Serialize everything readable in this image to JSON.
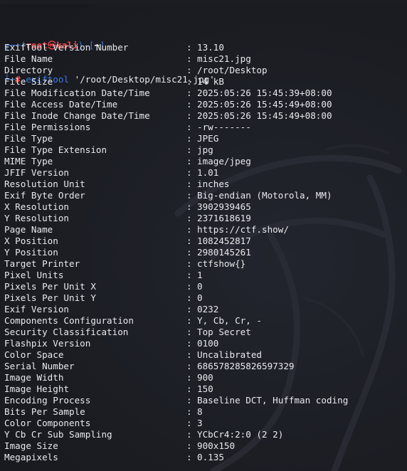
{
  "prompt": {
    "frame_top_left": "┌──",
    "open_paren": "(",
    "user": "root",
    "at_symbol": "㉿",
    "host": "kali",
    "close_paren": ")",
    "dash": "-",
    "open_bracket": "[",
    "cwd": "~",
    "close_bracket": "]",
    "frame_bottom_left": "└─",
    "hash": "#",
    "command": "exiftool",
    "argument": "'/root/Desktop/misc21.jpg'"
  },
  "separator": ":",
  "rows": [
    {
      "tag": "ExifTool Version Number",
      "value": "13.10"
    },
    {
      "tag": "File Name",
      "value": "misc21.jpg"
    },
    {
      "tag": "Directory",
      "value": "/root/Desktop"
    },
    {
      "tag": "File Size",
      "value": "14 kB"
    },
    {
      "tag": "File Modification Date/Time",
      "value": "2025:05:26 15:45:39+08:00"
    },
    {
      "tag": "File Access Date/Time",
      "value": "2025:05:26 15:45:49+08:00"
    },
    {
      "tag": "File Inode Change Date/Time",
      "value": "2025:05:26 15:45:49+08:00"
    },
    {
      "tag": "File Permissions",
      "value": "-rw-------"
    },
    {
      "tag": "File Type",
      "value": "JPEG"
    },
    {
      "tag": "File Type Extension",
      "value": "jpg"
    },
    {
      "tag": "MIME Type",
      "value": "image/jpeg"
    },
    {
      "tag": "JFIF Version",
      "value": "1.01"
    },
    {
      "tag": "Resolution Unit",
      "value": "inches"
    },
    {
      "tag": "Exif Byte Order",
      "value": "Big-endian (Motorola, MM)"
    },
    {
      "tag": "X Resolution",
      "value": "3902939465"
    },
    {
      "tag": "Y Resolution",
      "value": "2371618619"
    },
    {
      "tag": "Page Name",
      "value": "https://ctf.show/"
    },
    {
      "tag": "X Position",
      "value": "1082452817"
    },
    {
      "tag": "Y Position",
      "value": "2980145261"
    },
    {
      "tag": "Target Printer",
      "value": "ctfshow{}"
    },
    {
      "tag": "Pixel Units",
      "value": "1"
    },
    {
      "tag": "Pixels Per Unit X",
      "value": "0"
    },
    {
      "tag": "Pixels Per Unit Y",
      "value": "0"
    },
    {
      "tag": "Exif Version",
      "value": "0232"
    },
    {
      "tag": "Components Configuration",
      "value": "Y, Cb, Cr, -"
    },
    {
      "tag": "Security Classification",
      "value": "Top Secret"
    },
    {
      "tag": "Flashpix Version",
      "value": "0100"
    },
    {
      "tag": "Color Space",
      "value": "Uncalibrated"
    },
    {
      "tag": "Serial Number",
      "value": "686578285826597329"
    },
    {
      "tag": "Image Width",
      "value": "900"
    },
    {
      "tag": "Image Height",
      "value": "150"
    },
    {
      "tag": "Encoding Process",
      "value": "Baseline DCT, Huffman coding"
    },
    {
      "tag": "Bits Per Sample",
      "value": "8"
    },
    {
      "tag": "Color Components",
      "value": "3"
    },
    {
      "tag": "Y Cb Cr Sub Sampling",
      "value": "YCbCr4:2:0 (2 2)"
    },
    {
      "tag": "Image Size",
      "value": "900x150"
    },
    {
      "tag": "Megapixels",
      "value": "0.135"
    }
  ]
}
